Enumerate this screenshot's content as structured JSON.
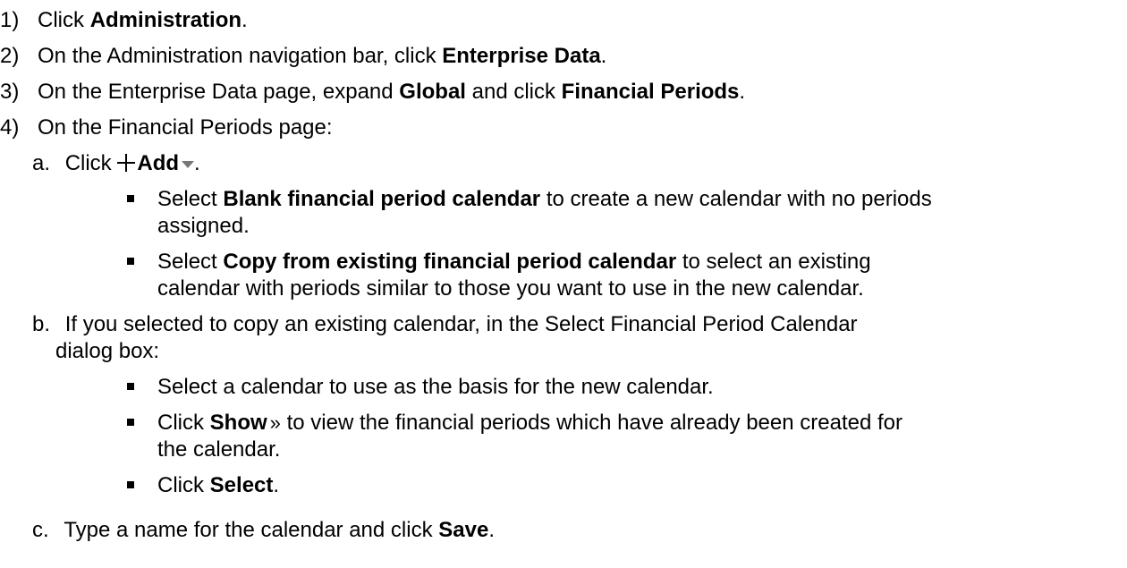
{
  "steps": {
    "s1": {
      "num": "1)",
      "pre": "Click ",
      "b1": "Administration",
      "post": "."
    },
    "s2": {
      "num": "2)",
      "pre": "On the Administration navigation bar, click ",
      "b1": "Enterprise Data",
      "post": "."
    },
    "s3": {
      "num": "3)",
      "pre": "On the Enterprise Data page, expand ",
      "b1": "Global",
      "mid": " and click ",
      "b2": "Financial Periods",
      "post": "."
    },
    "s4": {
      "num": "4)",
      "pre": "On the Financial Periods page:"
    }
  },
  "sub": {
    "a": {
      "letter": "a.",
      "pre": "Click ",
      "b1": "Add",
      "post": "."
    },
    "b": {
      "letter": "b.",
      "l1": "If you selected to copy an existing calendar, in the Select Financial Period Calendar",
      "l2": "dialog box:"
    },
    "c": {
      "letter": "c.",
      "pre": "Type a name for the calendar and click ",
      "b1": "Save",
      "post": "."
    }
  },
  "bullets": {
    "a1": {
      "pre": "Select ",
      "b1": "Blank financial period calendar",
      "post": " to create a new calendar with no periods",
      "l2": "assigned."
    },
    "a2": {
      "pre": "Select ",
      "b1": "Copy from existing financial period calendar",
      "post": " to select an existing",
      "l2": "calendar with periods similar to those you want to use in the new calendar."
    },
    "b1": {
      "text": "Select a calendar to use as the basis for the new calendar."
    },
    "b2": {
      "pre": "Click ",
      "b1": "Show",
      "post": " to view the financial periods which have already been created for",
      "l2": "the calendar."
    },
    "b3": {
      "pre": "Click ",
      "b1": "Select",
      "post": "."
    }
  },
  "icons": {
    "chevron": "»"
  }
}
